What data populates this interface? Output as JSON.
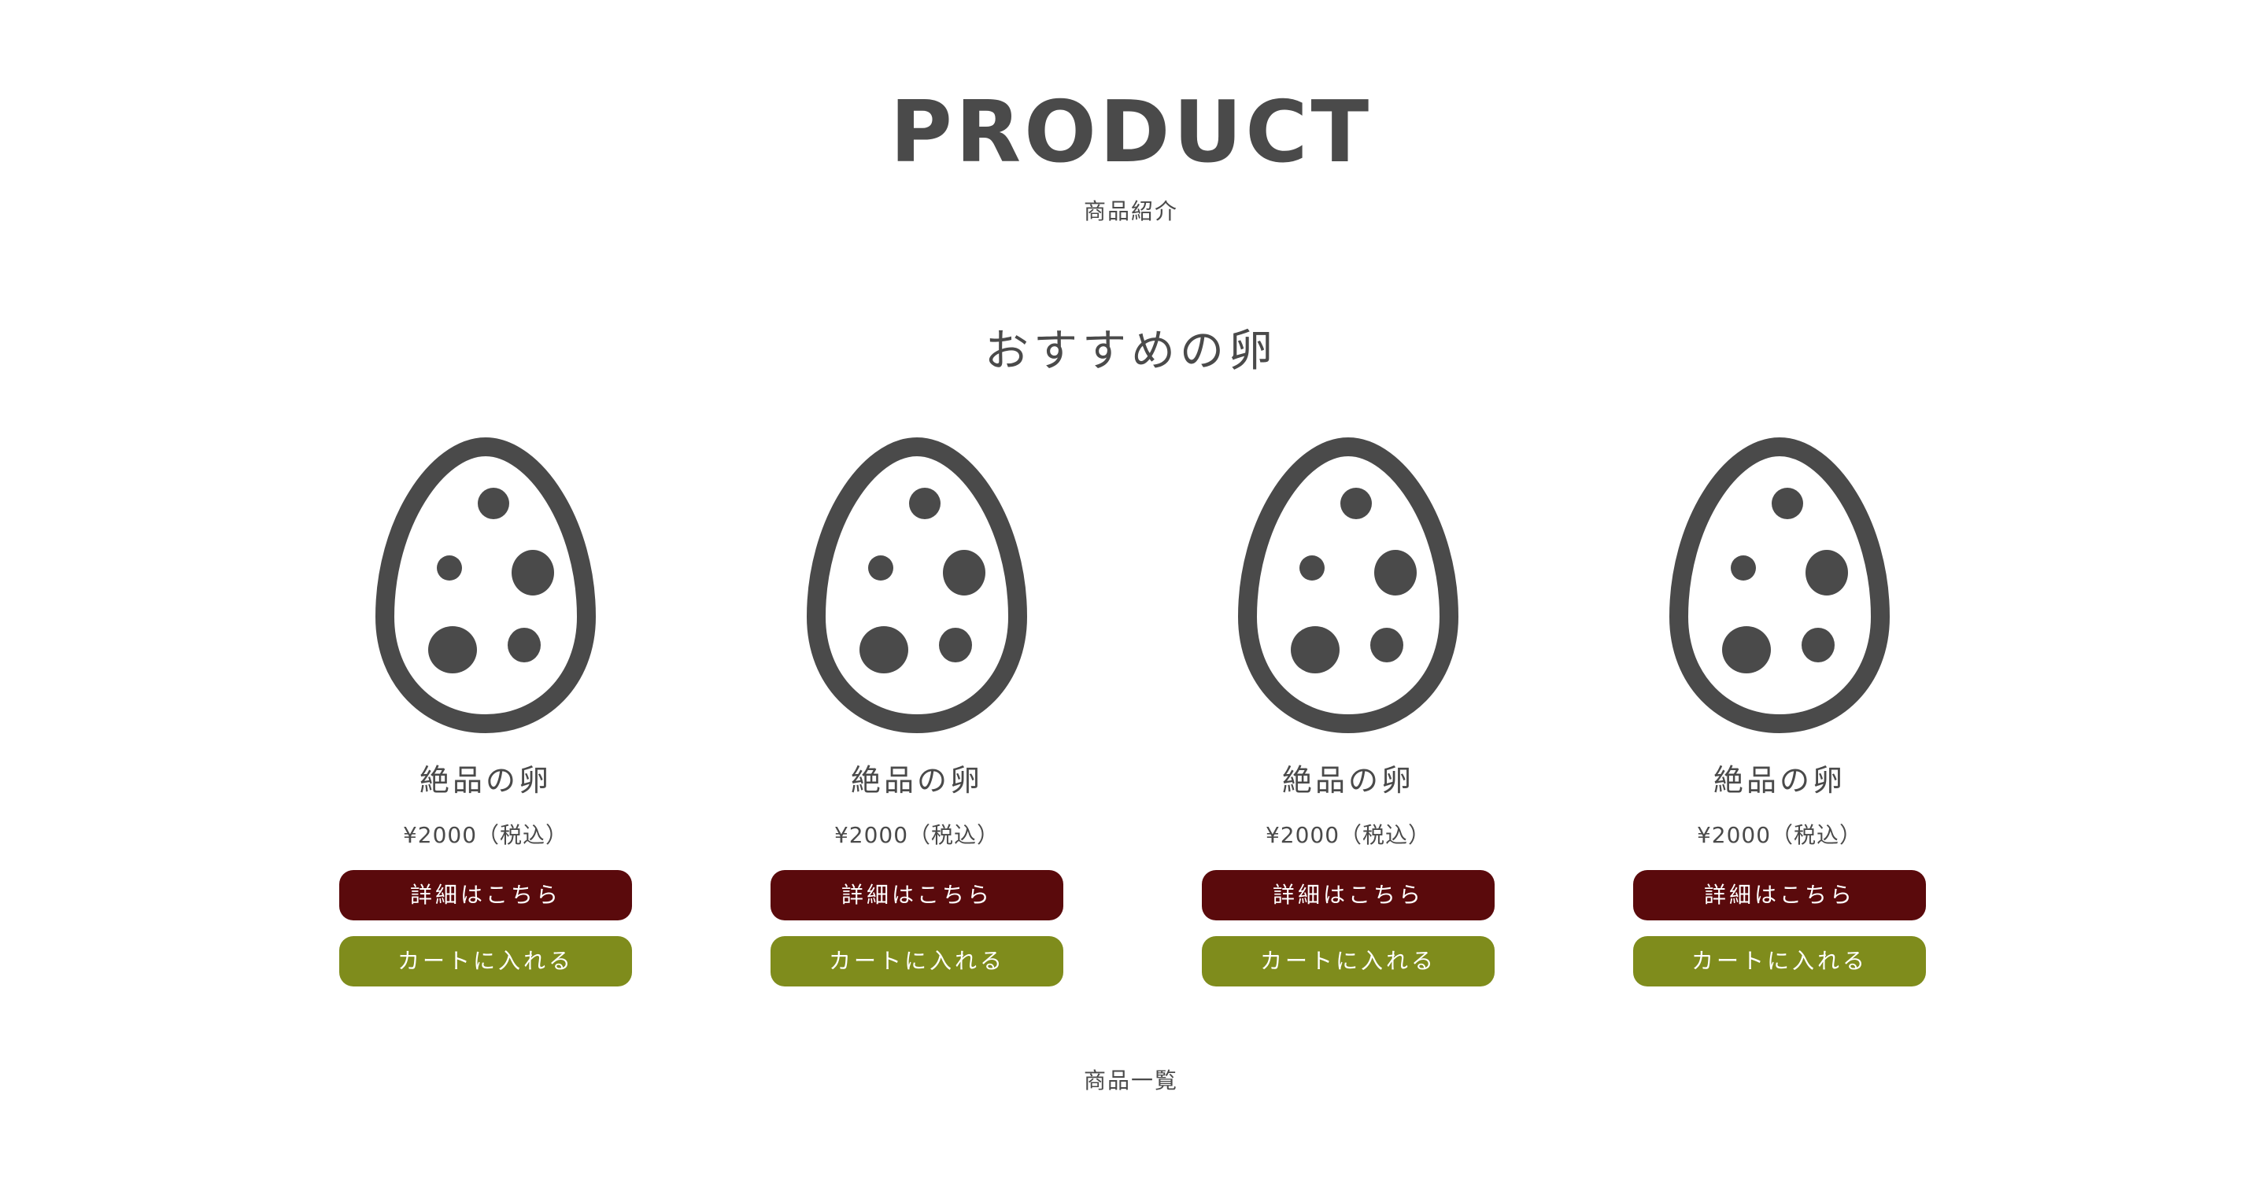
{
  "header": {
    "title": "PRODUCT",
    "subtitle": "商品紹介"
  },
  "section": {
    "heading": "おすすめの卵"
  },
  "products": [
    {
      "name": "絶品の卵",
      "price": "¥2000（税込）",
      "detail_label": "詳細はこちら",
      "cart_label": "カートに入れる",
      "icon": "egg-icon"
    },
    {
      "name": "絶品の卵",
      "price": "¥2000（税込）",
      "detail_label": "詳細はこちら",
      "cart_label": "カートに入れる",
      "icon": "egg-icon"
    },
    {
      "name": "絶品の卵",
      "price": "¥2000（税込）",
      "detail_label": "詳細はこちら",
      "cart_label": "カートに入れる",
      "icon": "egg-icon"
    },
    {
      "name": "絶品の卵",
      "price": "¥2000（税込）",
      "detail_label": "詳細はこちら",
      "cart_label": "カートに入れる",
      "icon": "egg-icon"
    }
  ],
  "footer": {
    "link_label": "商品一覧"
  },
  "colors": {
    "text": "#4a4a4a",
    "detail_button": "#5a0a0c",
    "cart_button": "#7f8c1c",
    "button_text": "#ffffff",
    "background": "#ffffff"
  }
}
